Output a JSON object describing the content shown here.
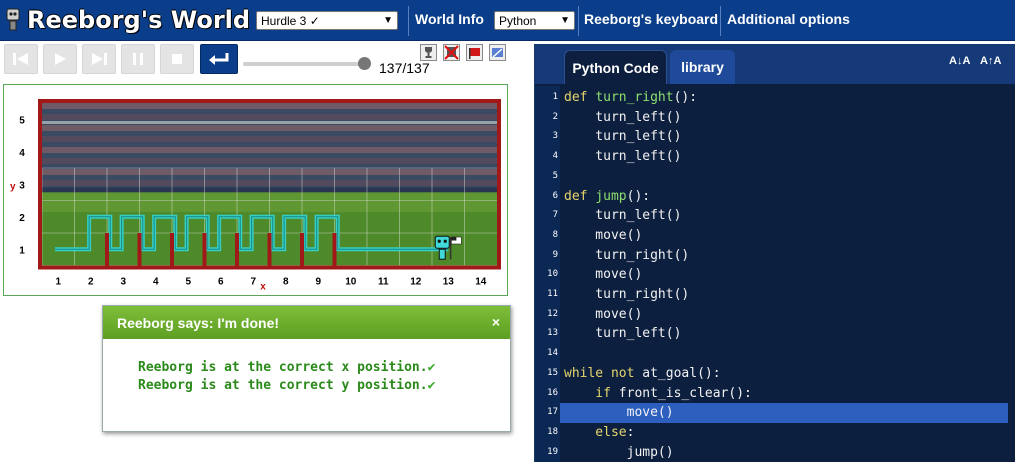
{
  "header": {
    "app_title": "Reeborg's World",
    "world_select": "Hurdle 3 ✓",
    "world_info_label": "World Info",
    "language_select": "Python",
    "keyboard_label": "Reeborg's keyboard",
    "options_label": "Additional options",
    "colors": {
      "bar": "#0a3d8a"
    }
  },
  "controls": {
    "buttons": [
      "rewind-icon",
      "play-icon",
      "step-forward-icon",
      "pause-icon",
      "stop-icon",
      "return-icon"
    ],
    "step_counter": "137/137",
    "progress": 1.0,
    "tool_icons": [
      "trophy-icon",
      "robot-icon",
      "flag-icon",
      "world-edit-icon"
    ]
  },
  "world": {
    "y_axis_label": "y",
    "x_axis_label": "x",
    "y_ticks": [
      "5",
      "4",
      "3",
      "2",
      "1"
    ],
    "x_ticks": [
      "1",
      "2",
      "3",
      "4",
      "5",
      "6",
      "7",
      "8",
      "9",
      "10",
      "11",
      "12",
      "13",
      "14"
    ],
    "robot_position": {
      "x": 13,
      "y": 1
    },
    "goal_position": {
      "x": 13,
      "y": 1
    },
    "wall_columns": [
      2,
      3,
      4,
      5,
      6,
      7,
      8,
      9
    ],
    "colors": {
      "walls": "#a01818",
      "trace": "#33d6d6",
      "grass": "#4f8a2a"
    }
  },
  "message": {
    "title": "Reeborg says: I'm done!",
    "close_label": "×",
    "lines": [
      "Reeborg is at the correct x position.",
      "Reeborg is at the correct y position."
    ],
    "check": "✔"
  },
  "editor": {
    "tabs": [
      "Python Code",
      "library"
    ],
    "active_tab": "Python Code",
    "font_buttons": [
      "A↓A",
      "A↑A"
    ],
    "highlighted_line": 17,
    "lines": [
      {
        "n": "1",
        "tokens": [
          [
            "kw",
            "def "
          ],
          [
            "fn",
            "turn_right"
          ],
          [
            "",
            "():"
          ]
        ]
      },
      {
        "n": "2",
        "tokens": [
          [
            "",
            "    turn_left()"
          ]
        ]
      },
      {
        "n": "3",
        "tokens": [
          [
            "",
            "    turn_left()"
          ]
        ]
      },
      {
        "n": "4",
        "tokens": [
          [
            "",
            "    turn_left()"
          ]
        ]
      },
      {
        "n": "5",
        "tokens": [
          [
            "",
            ""
          ]
        ]
      },
      {
        "n": "6",
        "tokens": [
          [
            "kw",
            "def "
          ],
          [
            "fn",
            "jump"
          ],
          [
            "",
            "():"
          ]
        ]
      },
      {
        "n": "7",
        "tokens": [
          [
            "",
            "    turn_left()"
          ]
        ]
      },
      {
        "n": "8",
        "tokens": [
          [
            "",
            "    move()"
          ]
        ]
      },
      {
        "n": "9",
        "tokens": [
          [
            "",
            "    turn_right()"
          ]
        ]
      },
      {
        "n": "10",
        "tokens": [
          [
            "",
            "    move()"
          ]
        ]
      },
      {
        "n": "11",
        "tokens": [
          [
            "",
            "    turn_right()"
          ]
        ]
      },
      {
        "n": "12",
        "tokens": [
          [
            "",
            "    move()"
          ]
        ]
      },
      {
        "n": "13",
        "tokens": [
          [
            "",
            "    turn_left()"
          ]
        ]
      },
      {
        "n": "14",
        "tokens": [
          [
            "",
            ""
          ]
        ]
      },
      {
        "n": "15",
        "tokens": [
          [
            "kw",
            "while not "
          ],
          [
            "",
            "at_goal():"
          ]
        ]
      },
      {
        "n": "16",
        "tokens": [
          [
            "kw",
            "    if "
          ],
          [
            "",
            "front_is_clear():"
          ]
        ]
      },
      {
        "n": "17",
        "tokens": [
          [
            "",
            "        move()"
          ]
        ]
      },
      {
        "n": "18",
        "tokens": [
          [
            "kw",
            "    else"
          ],
          [
            "",
            ":"
          ]
        ]
      },
      {
        "n": "19",
        "tokens": [
          [
            "",
            "        jump()"
          ]
        ]
      }
    ]
  }
}
